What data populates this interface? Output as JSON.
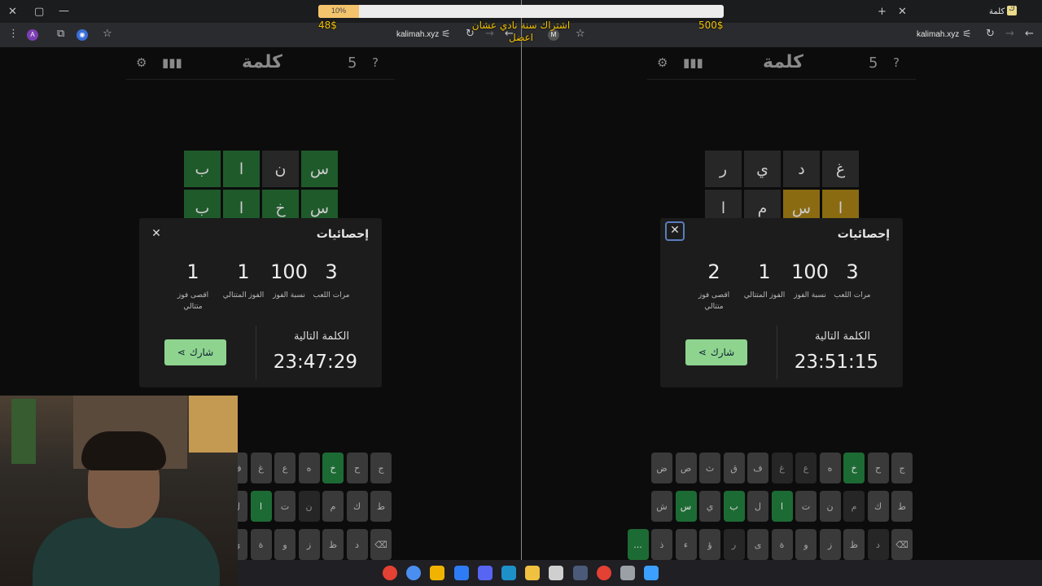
{
  "overlay": {
    "progress_text": "10%",
    "progress_fraction": 0.1,
    "left_amount": "48$",
    "right_amount": "500$",
    "banner_line1": "اشتراك سنة نادي عشان",
    "banner_line2": "اعضل"
  },
  "browser_left": {
    "url": "kalimah.xyz",
    "avatar_a": "A",
    "avatar_m": "M"
  },
  "browser_right": {
    "url": "kalimah.xyz",
    "tab_title": "كلمة"
  },
  "game": {
    "logo": "كلمة",
    "streak_number": "5"
  },
  "left_board": {
    "rows": [
      [
        {
          "l": "س",
          "s": "g"
        },
        {
          "l": "ن",
          "s": "n"
        },
        {
          "l": "ا",
          "s": "g"
        },
        {
          "l": "ب",
          "s": "g"
        }
      ],
      [
        {
          "l": "س",
          "s": "g"
        },
        {
          "l": "خ",
          "s": "g"
        },
        {
          "l": "ا",
          "s": "g"
        },
        {
          "l": "ب",
          "s": "g"
        }
      ]
    ]
  },
  "right_board": {
    "rows": [
      [
        {
          "l": "غ",
          "s": "n"
        },
        {
          "l": "د",
          "s": "n"
        },
        {
          "l": "ي",
          "s": "n"
        },
        {
          "l": "ر",
          "s": "n"
        }
      ],
      [
        {
          "l": "ا",
          "s": "y"
        },
        {
          "l": "س",
          "s": "y"
        },
        {
          "l": "م",
          "s": "n"
        },
        {
          "l": "ا",
          "s": "n"
        }
      ]
    ]
  },
  "stats_left": {
    "title": "إحصائيات",
    "played": "3",
    "played_label": "مرات اللعب",
    "win_pct": "100",
    "win_pct_label": "نسبة الفوز",
    "streak": "1",
    "streak_label": "الفوز المتتالي",
    "max_streak": "1",
    "max_streak_label": "اقصى فوز متتالي",
    "next_label": "الكلمة التالية",
    "timer": "23:47:29",
    "share_label": "شارك"
  },
  "stats_right": {
    "title": "إحصائيات",
    "played": "3",
    "played_label": "مرات اللعب",
    "win_pct": "100",
    "win_pct_label": "نسبة الفوز",
    "streak": "1",
    "streak_label": "الفوز المتتالي",
    "max_streak": "2",
    "max_streak_label": "اقصى فوز متتالي",
    "next_label": "الكلمة التالية",
    "timer": "23:51:15",
    "share_label": "شارك"
  },
  "keyboard_right": {
    "row1": [
      {
        "k": "ج",
        "s": ""
      },
      {
        "k": "ح",
        "s": ""
      },
      {
        "k": "خ",
        "s": "g"
      },
      {
        "k": "ه",
        "s": ""
      },
      {
        "k": "ع",
        "s": "d"
      },
      {
        "k": "غ",
        "s": "d"
      },
      {
        "k": "ف",
        "s": ""
      },
      {
        "k": "ق",
        "s": ""
      },
      {
        "k": "ث",
        "s": ""
      },
      {
        "k": "ص",
        "s": ""
      },
      {
        "k": "ض",
        "s": ""
      }
    ],
    "row2": [
      {
        "k": "ط",
        "s": ""
      },
      {
        "k": "ك",
        "s": ""
      },
      {
        "k": "م",
        "s": "d"
      },
      {
        "k": "ن",
        "s": ""
      },
      {
        "k": "ت",
        "s": ""
      },
      {
        "k": "ا",
        "s": "g"
      },
      {
        "k": "ل",
        "s": ""
      },
      {
        "k": "ب",
        "s": "g"
      },
      {
        "k": "ي",
        "s": ""
      },
      {
        "k": "س",
        "s": "g"
      },
      {
        "k": "ش",
        "s": ""
      }
    ],
    "row3": [
      {
        "k": "⌫",
        "s": ""
      },
      {
        "k": "د",
        "s": "d"
      },
      {
        "k": "ظ",
        "s": ""
      },
      {
        "k": "ز",
        "s": ""
      },
      {
        "k": "و",
        "s": ""
      },
      {
        "k": "ة",
        "s": ""
      },
      {
        "k": "ى",
        "s": ""
      },
      {
        "k": "ر",
        "s": "d"
      },
      {
        "k": "ؤ",
        "s": ""
      },
      {
        "k": "ء",
        "s": ""
      },
      {
        "k": "ذ",
        "s": ""
      },
      {
        "k": "...",
        "s": "g"
      }
    ]
  },
  "keyboard_left": {
    "row1": [
      {
        "k": "ج",
        "s": ""
      },
      {
        "k": "ح",
        "s": ""
      },
      {
        "k": "خ",
        "s": "g"
      },
      {
        "k": "ه",
        "s": ""
      },
      {
        "k": "ع",
        "s": ""
      },
      {
        "k": "غ",
        "s": ""
      },
      {
        "k": "ف",
        "s": ""
      }
    ],
    "row2": [
      {
        "k": "ط",
        "s": ""
      },
      {
        "k": "ك",
        "s": ""
      },
      {
        "k": "م",
        "s": ""
      },
      {
        "k": "ن",
        "s": "d"
      },
      {
        "k": "ت",
        "s": ""
      },
      {
        "k": "ا",
        "s": "g"
      },
      {
        "k": "ل",
        "s": ""
      }
    ],
    "row3": [
      {
        "k": "⌫",
        "s": ""
      },
      {
        "k": "د",
        "s": ""
      },
      {
        "k": "ظ",
        "s": ""
      },
      {
        "k": "ز",
        "s": ""
      },
      {
        "k": "و",
        "s": ""
      },
      {
        "k": "ة",
        "s": ""
      },
      {
        "k": "ى",
        "s": ""
      }
    ]
  },
  "taskbar_icons": [
    "chrome-icon",
    "chrome-beta-icon",
    "rockstar-icon",
    "media-player-icon",
    "discord-icon",
    "edge-icon",
    "file-explorer-icon",
    "obs-icon",
    "steam-icon",
    "chrome-icon-2",
    "settings-icon",
    "windows-start-icon"
  ],
  "colors": {
    "correct": "#1f5a2b",
    "present": "#8a6b12",
    "absent": "#272727",
    "share": "#8ed48f"
  }
}
